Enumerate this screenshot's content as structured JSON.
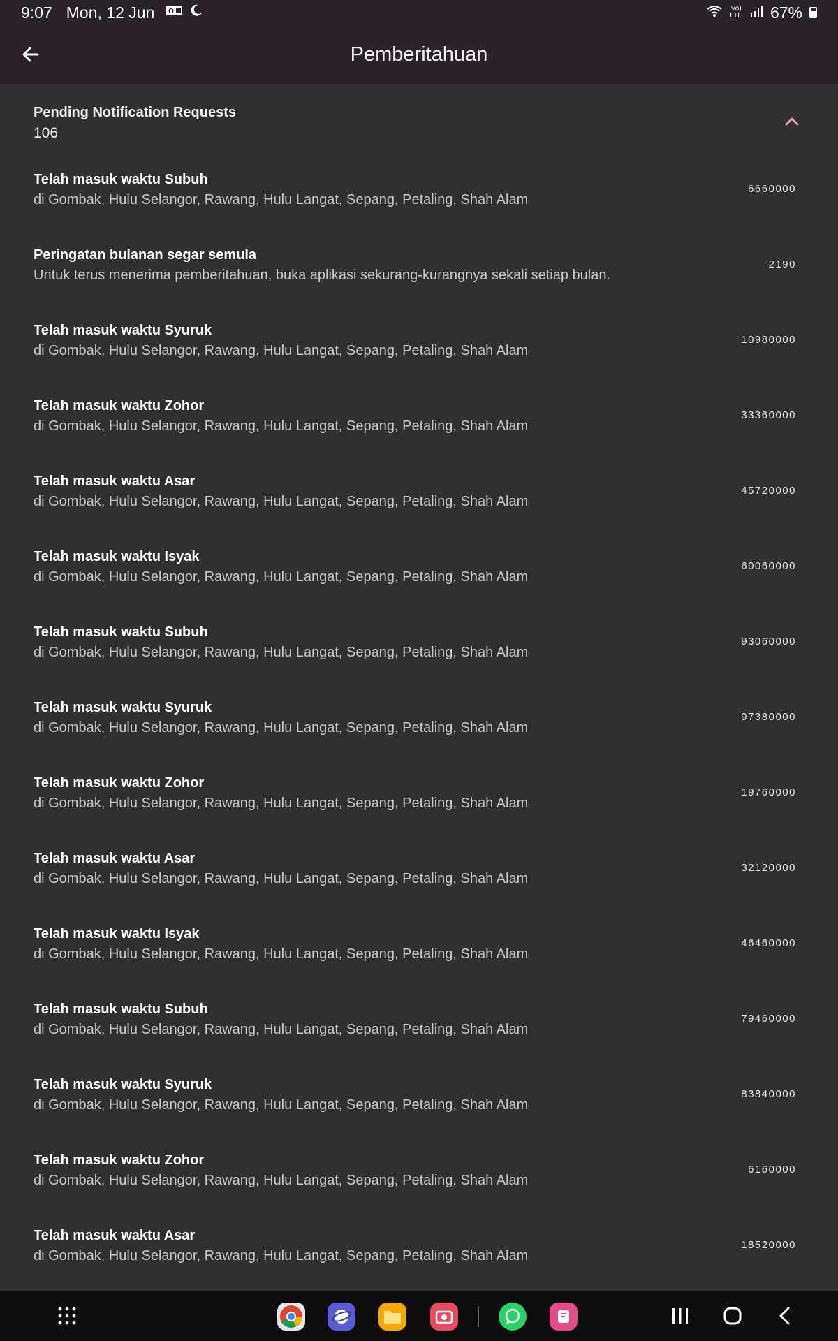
{
  "status_bar": {
    "time": "9:07",
    "date": "Mon, 12 Jun",
    "battery": "67%"
  },
  "app_bar": {
    "title": "Pemberitahuan",
    "back_icon": "arrow-back-icon"
  },
  "summary": {
    "label": "Pending Notification Requests",
    "count": "106",
    "toggle_icon": "chevron-up-icon"
  },
  "notifications": [
    {
      "title": "Telah masuk waktu Subuh",
      "body": "di Gombak, Hulu Selangor, Rawang, Hulu Langat, Sepang, Petaling, Shah Alam",
      "id": "6660000"
    },
    {
      "title": "Peringatan bulanan segar semula",
      "body": "Untuk terus menerima pemberitahuan, buka aplikasi sekurang-kurangnya sekali setiap bulan.",
      "id": "2190"
    },
    {
      "title": "Telah masuk waktu Syuruk",
      "body": "di Gombak, Hulu Selangor, Rawang, Hulu Langat, Sepang, Petaling, Shah Alam",
      "id": "10980000"
    },
    {
      "title": "Telah masuk waktu Zohor",
      "body": "di Gombak, Hulu Selangor, Rawang, Hulu Langat, Sepang, Petaling, Shah Alam",
      "id": "33360000"
    },
    {
      "title": "Telah masuk waktu Asar",
      "body": "di Gombak, Hulu Selangor, Rawang, Hulu Langat, Sepang, Petaling, Shah Alam",
      "id": "45720000"
    },
    {
      "title": "Telah masuk waktu Isyak",
      "body": "di Gombak, Hulu Selangor, Rawang, Hulu Langat, Sepang, Petaling, Shah Alam",
      "id": "60060000"
    },
    {
      "title": "Telah masuk waktu Subuh",
      "body": "di Gombak, Hulu Selangor, Rawang, Hulu Langat, Sepang, Petaling, Shah Alam",
      "id": "93060000"
    },
    {
      "title": "Telah masuk waktu Syuruk",
      "body": "di Gombak, Hulu Selangor, Rawang, Hulu Langat, Sepang, Petaling, Shah Alam",
      "id": "97380000"
    },
    {
      "title": "Telah masuk waktu Zohor",
      "body": "di Gombak, Hulu Selangor, Rawang, Hulu Langat, Sepang, Petaling, Shah Alam",
      "id": "19760000"
    },
    {
      "title": "Telah masuk waktu Asar",
      "body": "di Gombak, Hulu Selangor, Rawang, Hulu Langat, Sepang, Petaling, Shah Alam",
      "id": "32120000"
    },
    {
      "title": "Telah masuk waktu Isyak",
      "body": "di Gombak, Hulu Selangor, Rawang, Hulu Langat, Sepang, Petaling, Shah Alam",
      "id": "46460000"
    },
    {
      "title": "Telah masuk waktu Subuh",
      "body": "di Gombak, Hulu Selangor, Rawang, Hulu Langat, Sepang, Petaling, Shah Alam",
      "id": "79460000"
    },
    {
      "title": "Telah masuk waktu Syuruk",
      "body": "di Gombak, Hulu Selangor, Rawang, Hulu Langat, Sepang, Petaling, Shah Alam",
      "id": "83840000"
    },
    {
      "title": "Telah masuk waktu Zohor",
      "body": "di Gombak, Hulu Selangor, Rawang, Hulu Langat, Sepang, Petaling, Shah Alam",
      "id": "6160000"
    },
    {
      "title": "Telah masuk waktu Asar",
      "body": "di Gombak, Hulu Selangor, Rawang, Hulu Langat, Sepang, Petaling, Shah Alam",
      "id": "18520000"
    }
  ],
  "nav_bar": {
    "apps": [
      {
        "name": "chrome-icon",
        "color": "#e0e0e0"
      },
      {
        "name": "samsung-internet-icon",
        "color": "#5b5bd6"
      },
      {
        "name": "my-files-icon",
        "color": "#f2a900"
      },
      {
        "name": "screen-recorder-icon",
        "color": "#e84a5f"
      },
      {
        "name": "whatsapp-icon",
        "color": "#25d366"
      },
      {
        "name": "notes-app-icon",
        "color": "#e64a8a"
      }
    ]
  },
  "colors": {
    "background": "#303030",
    "app_bar": "#2a2323",
    "accent": "#e8a0c8"
  }
}
